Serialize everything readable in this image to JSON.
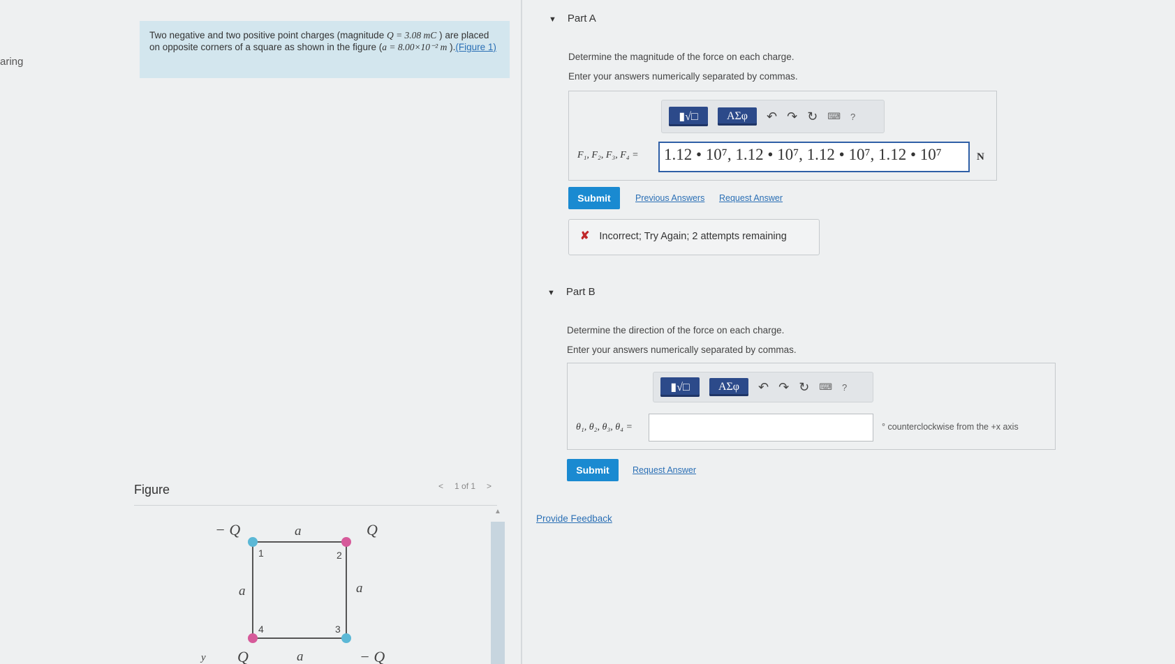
{
  "left_cut_text": "aring",
  "problem": {
    "text_1": "Two negative and two positive point charges (magnitude ",
    "q_expr": "Q = 3.08 mC",
    "text_2": " ) are placed on opposite corners of a square as shown in the figure (",
    "a_expr": "a = 8.00×10⁻² m",
    "text_3": " ).",
    "figure_link": "(Figure 1)"
  },
  "figure": {
    "label": "Figure",
    "pager_prev": "<",
    "pager_text": "1 of 1",
    "pager_next": ">",
    "charge_labels": {
      "top_left": "− Q",
      "top_right": "Q",
      "bottom_right": "− Q",
      "bottom_left": "Q",
      "y_axis": "y"
    },
    "side_labels": {
      "top": "a",
      "left": "a",
      "right": "a",
      "bottom": "a"
    },
    "corner_numbers": {
      "c1": "1",
      "c2": "2",
      "c3": "3",
      "c4": "4"
    },
    "colors": {
      "negative": "#5bb8d6",
      "positive": "#d65a9a",
      "square": "#555555"
    }
  },
  "part_a": {
    "title": "Part A",
    "prompt_1": "Determine the magnitude of the force on each charge.",
    "prompt_2": "Enter your answers numerically separated by commas.",
    "toolbar": {
      "templates": "▮√□",
      "symbols": "ΑΣφ",
      "undo": "↶",
      "redo": "↷",
      "reset": "↻",
      "keyboard": "⌨",
      "help": "?"
    },
    "eq_label": "F₁, F₂, F₃, F₄ =",
    "answer_value": "1.12 • 10⁷, 1.12 • 10⁷, 1.12 • 10⁷, 1.12 • 10⁷",
    "unit": "N",
    "submit": "Submit",
    "previous_answers": "Previous Answers",
    "request_answer": "Request Answer",
    "feedback_icon": "✘",
    "feedback_text": "Incorrect; Try Again; 2 attempts remaining"
  },
  "part_b": {
    "title": "Part B",
    "prompt_1": "Determine the direction of the force on each charge.",
    "prompt_2": "Enter your answers numerically separated by commas.",
    "toolbar": {
      "templates": "▮√□",
      "symbols": "ΑΣφ",
      "undo": "↶",
      "redo": "↷",
      "reset": "↻",
      "keyboard": "⌨",
      "help": "?"
    },
    "eq_label": "θ₁, θ₂, θ₃, θ₄ =",
    "answer_value": "",
    "unit_text": "° counterclockwise from the +x axis",
    "submit": "Submit",
    "request_answer": "Request Answer"
  },
  "provide_feedback": "Provide Feedback",
  "accent": "#1a8ad1"
}
